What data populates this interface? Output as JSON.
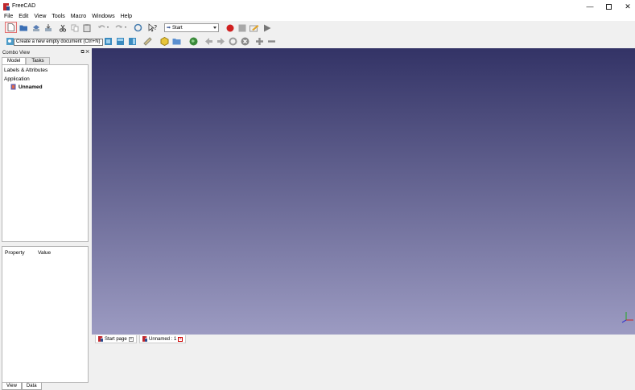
{
  "window": {
    "title": "FreeCAD"
  },
  "menu": [
    "File",
    "Edit",
    "View",
    "Tools",
    "Macro",
    "Windows",
    "Help"
  ],
  "toolbar": {
    "workbench": "Start",
    "tooltip": "Create a new empty document (Ctrl+N)"
  },
  "combo": {
    "title": "Combo View",
    "tabs": [
      "Model",
      "Tasks"
    ],
    "tree_header": "Labels & Attributes",
    "app_label": "Application",
    "doc_label": "Unnamed"
  },
  "properties": {
    "col1": "Property",
    "col2": "Value"
  },
  "bottom_tabs": [
    "View",
    "Data"
  ],
  "doc_tabs": [
    "Start page",
    "Unnamed : 1"
  ],
  "colors": {
    "bg_top": "#333366",
    "bg_bottom": "#9c9bc2",
    "record": "#d02020"
  }
}
